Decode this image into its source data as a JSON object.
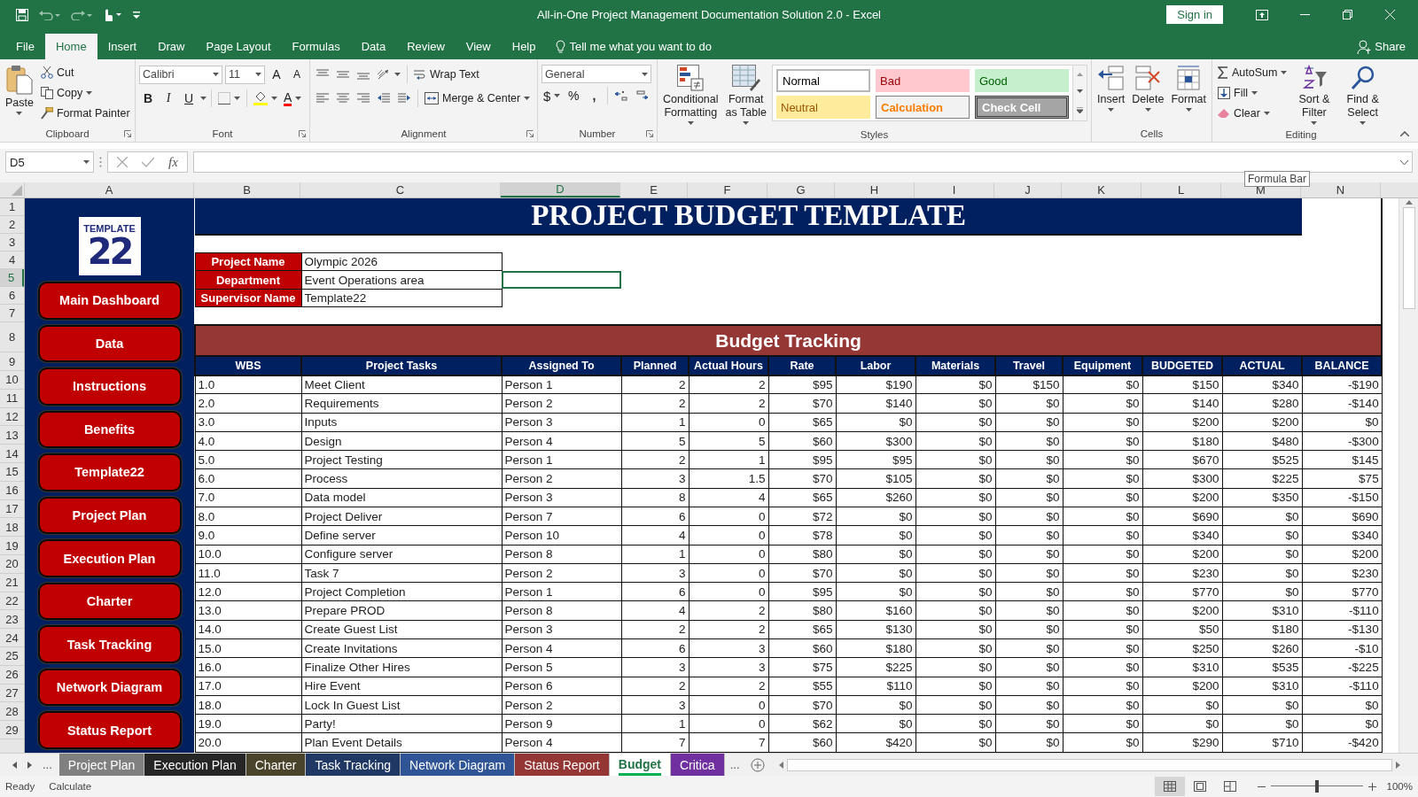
{
  "window": {
    "title": "All-in-One Project Management Documentation Solution 2.0  -  Excel",
    "sign_in": "Sign in",
    "share": "Share"
  },
  "ribbon_tabs": [
    {
      "label": "File",
      "selected": false
    },
    {
      "label": "Home",
      "selected": true
    },
    {
      "label": "Insert",
      "selected": false
    },
    {
      "label": "Draw",
      "selected": false
    },
    {
      "label": "Page Layout",
      "selected": false
    },
    {
      "label": "Formulas",
      "selected": false
    },
    {
      "label": "Data",
      "selected": false
    },
    {
      "label": "Review",
      "selected": false
    },
    {
      "label": "View",
      "selected": false
    },
    {
      "label": "Help",
      "selected": false
    }
  ],
  "tell_me": "Tell me what you want to do",
  "clipboard": {
    "paste": "Paste",
    "cut": "Cut",
    "copy": "Copy",
    "format_painter": "Format Painter",
    "label": "Clipboard"
  },
  "font": {
    "name": "Calibri",
    "size": "11",
    "grow": "A",
    "shrink": "A",
    "bold": "B",
    "italic": "I",
    "underline": "U",
    "font_color_letter": "A",
    "label": "Font"
  },
  "alignment": {
    "wrap_text": "Wrap Text",
    "merge_center": "Merge & Center",
    "label": "Alignment"
  },
  "number": {
    "format": "General",
    "currency": "$",
    "percent": "%",
    "comma": ",",
    "label": "Number"
  },
  "styles": {
    "conditional_formatting": "Conditional Formatting",
    "format_as_table": "Format as Table",
    "label": "Styles",
    "gallery": [
      {
        "label": "Normal",
        "kind": "normal"
      },
      {
        "label": "Bad",
        "kind": "bad"
      },
      {
        "label": "Good",
        "kind": "good"
      },
      {
        "label": "Neutral",
        "kind": "neutral"
      },
      {
        "label": "Calculation",
        "kind": "calculation"
      },
      {
        "label": "Check Cell",
        "kind": "check"
      }
    ]
  },
  "cells": {
    "insert": "Insert",
    "delete": "Delete",
    "format": "Format",
    "label": "Cells"
  },
  "editing": {
    "autosum": "AutoSum",
    "fill": "Fill",
    "clear": "Clear",
    "sort_filter": "Sort & Filter",
    "find_select": "Find & Select",
    "label": "Editing"
  },
  "formula_bar": {
    "name_box": "D5",
    "function_label": "fx",
    "tooltip": "Formula Bar"
  },
  "column_headers": [
    {
      "label": "A",
      "selected": false
    },
    {
      "label": "B",
      "selected": false
    },
    {
      "label": "C",
      "selected": false
    },
    {
      "label": "D",
      "selected": true
    },
    {
      "label": "E",
      "selected": false
    },
    {
      "label": "F",
      "selected": false
    },
    {
      "label": "G",
      "selected": false
    },
    {
      "label": "H",
      "selected": false
    },
    {
      "label": "I",
      "selected": false
    },
    {
      "label": "J",
      "selected": false
    },
    {
      "label": "K",
      "selected": false
    },
    {
      "label": "L",
      "selected": false
    },
    {
      "label": "M",
      "selected": false
    },
    {
      "label": "N",
      "selected": false
    }
  ],
  "row_headers": [
    {
      "label": "1",
      "selected": false
    },
    {
      "label": "2",
      "selected": false
    },
    {
      "label": "3",
      "selected": false
    },
    {
      "label": "4",
      "selected": false
    },
    {
      "label": "5",
      "selected": true
    },
    {
      "label": "6",
      "selected": false
    },
    {
      "label": "7",
      "selected": false
    },
    {
      "label": "8",
      "selected": false
    },
    {
      "label": "9",
      "selected": false
    },
    {
      "label": "10",
      "selected": false
    },
    {
      "label": "11",
      "selected": false
    },
    {
      "label": "12",
      "selected": false
    },
    {
      "label": "13",
      "selected": false
    },
    {
      "label": "14",
      "selected": false
    },
    {
      "label": "15",
      "selected": false
    },
    {
      "label": "16",
      "selected": false
    },
    {
      "label": "17",
      "selected": false
    },
    {
      "label": "18",
      "selected": false
    },
    {
      "label": "19",
      "selected": false
    },
    {
      "label": "20",
      "selected": false
    },
    {
      "label": "21",
      "selected": false
    },
    {
      "label": "22",
      "selected": false
    },
    {
      "label": "23",
      "selected": false
    },
    {
      "label": "24",
      "selected": false
    },
    {
      "label": "25",
      "selected": false
    },
    {
      "label": "26",
      "selected": false
    },
    {
      "label": "27",
      "selected": false
    },
    {
      "label": "28",
      "selected": false
    },
    {
      "label": "29",
      "selected": false
    }
  ],
  "logo": {
    "number": "22",
    "word": "TEMPLATE"
  },
  "nav_buttons": [
    "Main Dashboard",
    "Data",
    "Instructions",
    "Benefits",
    "Template22",
    "Project Plan",
    "Execution Plan",
    "Charter",
    "Task Tracking",
    "Network Diagram",
    "Status Report"
  ],
  "sheet_title": "PROJECT BUDGET TEMPLATE",
  "project_info": [
    {
      "label": "Project Name",
      "value": "Olympic 2026",
      "next_cell_selected": false
    },
    {
      "label": "Department",
      "value": "Event Operations area",
      "next_cell_selected": true
    },
    {
      "label": "Supervisor Name",
      "value": "Template22",
      "next_cell_selected": false
    }
  ],
  "section_title": "Budget Tracking",
  "table": {
    "columns": [
      {
        "label": "WBS",
        "kind": "text"
      },
      {
        "label": "Project Tasks",
        "kind": "text"
      },
      {
        "label": "Assigned To",
        "kind": "text"
      },
      {
        "label": "Planned",
        "kind": "number"
      },
      {
        "label": "Actual Hours",
        "kind": "number"
      },
      {
        "label": "Rate",
        "kind": "number"
      },
      {
        "label": "Labor",
        "kind": "number"
      },
      {
        "label": "Materials",
        "kind": "number"
      },
      {
        "label": "Travel",
        "kind": "number"
      },
      {
        "label": "Equipment",
        "kind": "number"
      },
      {
        "label": "BUDGETED",
        "kind": "number"
      },
      {
        "label": "ACTUAL",
        "kind": "number"
      },
      {
        "label": "BALANCE",
        "kind": "number"
      }
    ],
    "rows": [
      [
        "1.0",
        "Meet Client",
        "Person 1",
        "2",
        "2",
        "$95",
        "$190",
        "$0",
        "$150",
        "$0",
        "$150",
        "$340",
        "-$190"
      ],
      [
        "2.0",
        "Requirements",
        "Person 2",
        "2",
        "2",
        "$70",
        "$140",
        "$0",
        "$0",
        "$0",
        "$140",
        "$280",
        "-$140"
      ],
      [
        "3.0",
        "Inputs",
        "Person 3",
        "1",
        "0",
        "$65",
        "$0",
        "$0",
        "$0",
        "$0",
        "$200",
        "$200",
        "$0"
      ],
      [
        "4.0",
        "Design",
        "Person 4",
        "5",
        "5",
        "$60",
        "$300",
        "$0",
        "$0",
        "$0",
        "$180",
        "$480",
        "-$300"
      ],
      [
        "5.0",
        "Project Testing",
        "Person 1",
        "2",
        "1",
        "$95",
        "$95",
        "$0",
        "$0",
        "$0",
        "$670",
        "$525",
        "$145"
      ],
      [
        "6.0",
        "Process",
        "Person 2",
        "3",
        "1.5",
        "$70",
        "$105",
        "$0",
        "$0",
        "$0",
        "$300",
        "$225",
        "$75"
      ],
      [
        "7.0",
        "Data model",
        "Person 3",
        "8",
        "4",
        "$65",
        "$260",
        "$0",
        "$0",
        "$0",
        "$200",
        "$350",
        "-$150"
      ],
      [
        "8.0",
        "Project Deliver",
        "Person 7",
        "6",
        "0",
        "$72",
        "$0",
        "$0",
        "$0",
        "$0",
        "$690",
        "$0",
        "$690"
      ],
      [
        "9.0",
        "Define server",
        "Person 10",
        "4",
        "0",
        "$78",
        "$0",
        "$0",
        "$0",
        "$0",
        "$340",
        "$0",
        "$340"
      ],
      [
        "10.0",
        "Configure server",
        "Person 8",
        "1",
        "0",
        "$80",
        "$0",
        "$0",
        "$0",
        "$0",
        "$200",
        "$0",
        "$200"
      ],
      [
        "11.0",
        "Task 7",
        "Person 2",
        "3",
        "0",
        "$70",
        "$0",
        "$0",
        "$0",
        "$0",
        "$230",
        "$0",
        "$230"
      ],
      [
        "12.0",
        "Project Completion",
        "Person 1",
        "6",
        "0",
        "$95",
        "$0",
        "$0",
        "$0",
        "$0",
        "$770",
        "$0",
        "$770"
      ],
      [
        "13.0",
        "Prepare PROD",
        "Person 8",
        "4",
        "2",
        "$80",
        "$160",
        "$0",
        "$0",
        "$0",
        "$200",
        "$310",
        "-$110"
      ],
      [
        "14.0",
        "Create Guest List",
        "Person 3",
        "2",
        "2",
        "$65",
        "$130",
        "$0",
        "$0",
        "$0",
        "$50",
        "$180",
        "-$130"
      ],
      [
        "15.0",
        "Create Invitations",
        "Person 4",
        "6",
        "3",
        "$60",
        "$180",
        "$0",
        "$0",
        "$0",
        "$250",
        "$260",
        "-$10"
      ],
      [
        "16.0",
        "Finalize Other Hires",
        "Person 5",
        "3",
        "3",
        "$75",
        "$225",
        "$0",
        "$0",
        "$0",
        "$310",
        "$535",
        "-$225"
      ],
      [
        "17.0",
        "Hire Event",
        "Person 6",
        "2",
        "2",
        "$55",
        "$110",
        "$0",
        "$0",
        "$0",
        "$200",
        "$310",
        "-$110"
      ],
      [
        "18.0",
        "Lock In Guest List",
        "Person 2",
        "3",
        "0",
        "$70",
        "$0",
        "$0",
        "$0",
        "$0",
        "$0",
        "$0",
        "$0"
      ],
      [
        "19.0",
        "Party!",
        "Person 9",
        "1",
        "0",
        "$62",
        "$0",
        "$0",
        "$0",
        "$0",
        "$0",
        "$0",
        "$0"
      ],
      [
        "20.0",
        "Plan Event Details",
        "Person 4",
        "7",
        "7",
        "$60",
        "$420",
        "$0",
        "$0",
        "$0",
        "$290",
        "$710",
        "-$420"
      ]
    ]
  },
  "sheet_tabs": {
    "more_left": "...",
    "more_right": "...",
    "tabs": [
      {
        "label": "Project Plan",
        "color": "#808080",
        "selected": false
      },
      {
        "label": "Execution Plan",
        "color": "#262626",
        "selected": false
      },
      {
        "label": "Charter",
        "color": "#4a452a",
        "selected": false
      },
      {
        "label": "Task Tracking",
        "color": "#1f3864",
        "selected": false
      },
      {
        "label": "Network Diagram",
        "color": "#2f5597",
        "selected": false
      },
      {
        "label": "Status Report",
        "color": "#943634",
        "selected": false
      },
      {
        "label": "Budget",
        "color": "#00b050",
        "selected": true
      },
      {
        "label": "Critica",
        "color": "#7030a0",
        "selected": false
      }
    ]
  },
  "status_bar": {
    "ready": "Ready",
    "mode": "Calculate",
    "zoom": "100%",
    "zoom_slider": {
      "level": 0.5
    }
  }
}
